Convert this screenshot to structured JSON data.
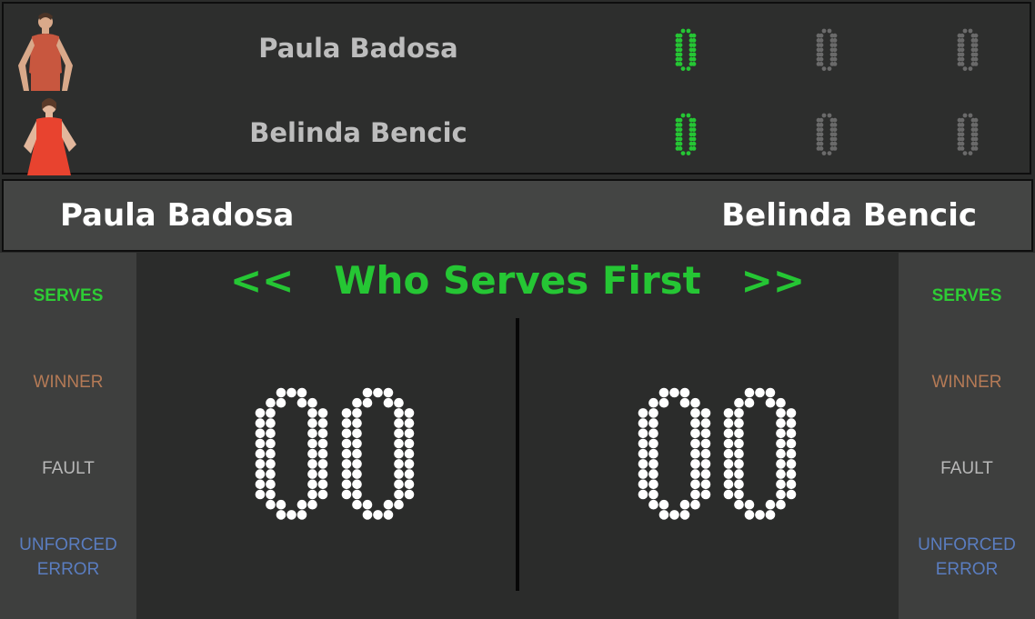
{
  "players": [
    {
      "name": "Paula Badosa",
      "scores": [
        "0",
        "0",
        "0"
      ],
      "outfit_color": "#c8573f"
    },
    {
      "name": "Belinda Bencic",
      "scores": [
        "0",
        "0",
        "0"
      ],
      "outfit_color": "#e8432f"
    }
  ],
  "name_bar": {
    "left": "Paula Badosa",
    "right": "Belinda Bencic"
  },
  "prompt": {
    "text": "Who Serves First",
    "left_arrow": "<<",
    "right_arrow": ">>"
  },
  "big_scores": {
    "left": [
      "0",
      "0"
    ],
    "right": [
      "0",
      "0"
    ]
  },
  "side_buttons": {
    "serves": "SERVES",
    "winner": "WINNER",
    "fault": "FAULT",
    "unforced_line1": "UNFORCED",
    "unforced_line2": "ERROR"
  },
  "colors": {
    "active_green": "#25c634",
    "inactive_digit": "#6a6a6a",
    "big_dot": "#ffffff",
    "winner": "#b47a56",
    "fault": "#b8b8b8",
    "unforced": "#5a7dc0"
  }
}
